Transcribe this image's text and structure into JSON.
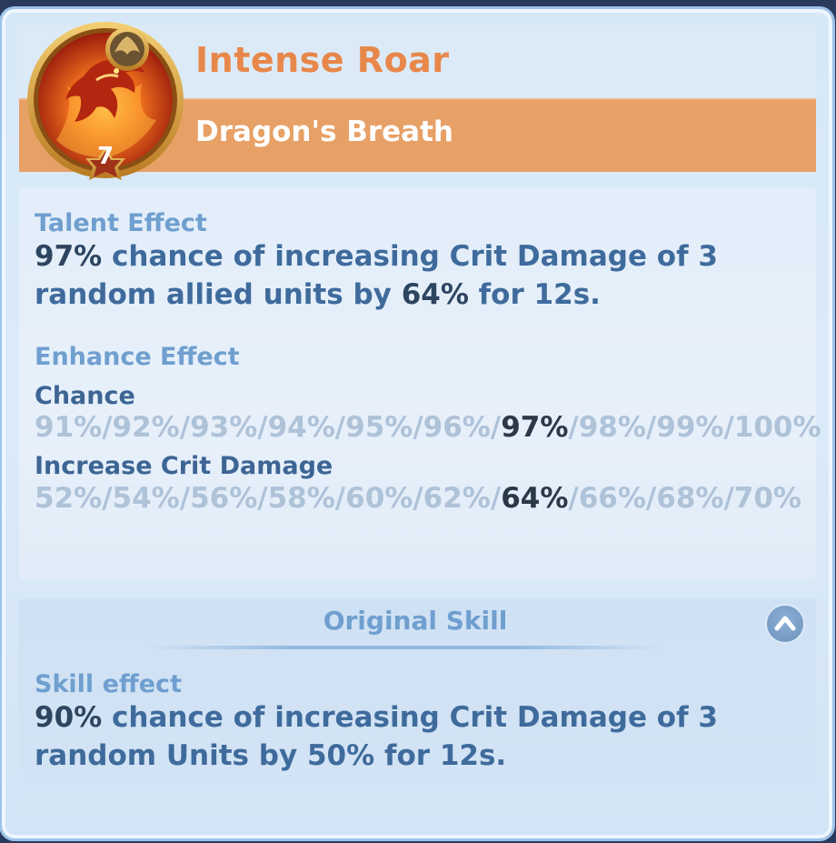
{
  "talent": {
    "name": "Intense Roar",
    "hero_name": "Dragon's Breath",
    "level": "7"
  },
  "talent_effect": {
    "label": "Talent Effect",
    "chance_value": "97%",
    "text_a": " chance of increasing Crit Damage of 3 random allied units by ",
    "damage_value": "64%",
    "text_b": " for 12s."
  },
  "enhance_effect": {
    "label": "Enhance Effect",
    "chance": {
      "label": "Chance",
      "values": [
        "91%",
        "92%",
        "93%",
        "94%",
        "95%",
        "96%",
        "97%",
        "98%",
        "99%",
        "100%"
      ],
      "current_index": 6
    },
    "crit_damage": {
      "label": "Increase Crit Damage",
      "values": [
        "52%",
        "54%",
        "56%",
        "58%",
        "60%",
        "62%",
        "64%",
        "66%",
        "68%",
        "70%"
      ],
      "current_index": 6
    }
  },
  "original_skill": {
    "title": "Original Skill",
    "effect_label": "Skill effect",
    "chance_value": "90%",
    "text": " chance of increasing Crit Damage of 3 random Units by 50% for 12s."
  },
  "colors": {
    "accent_orange": "#e8874a",
    "header_band": "#e7a066",
    "label_blue": "#6f9fcf",
    "text_blue": "#3f6b9c"
  },
  "icons": {
    "badge": "dragon-emblem-icon",
    "collapse": "chevron-up-icon"
  }
}
